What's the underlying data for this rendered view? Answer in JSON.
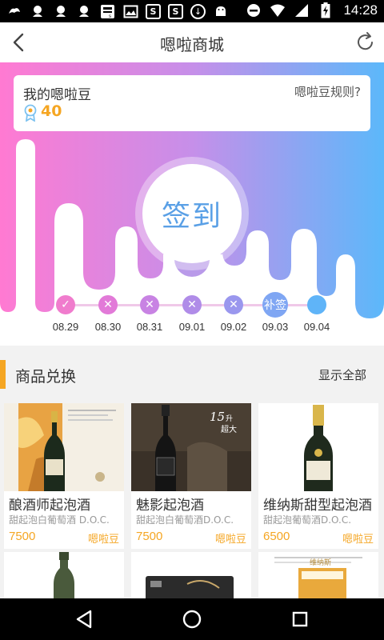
{
  "status_bar": {
    "time": "14:28",
    "icons": [
      "qq-icon",
      "qq-icon",
      "qq-icon",
      "qq-icon",
      "s-app-icon",
      "image-icon",
      "s5-icon",
      "s5-icon",
      "download-icon",
      "android-icon",
      "dnd-icon",
      "wifi-icon",
      "signal-icon",
      "battery-charging-icon"
    ]
  },
  "header": {
    "title": "嗯啦商城"
  },
  "beans": {
    "label": "我的嗯啦豆",
    "count": "40",
    "rules_label": "嗯啦豆规则?"
  },
  "signin": {
    "label": "签到"
  },
  "checkins": [
    {
      "date": "08.29",
      "status": "done",
      "symbol": "✓",
      "color": "#f07ccd"
    },
    {
      "date": "08.30",
      "status": "missed",
      "symbol": "✕",
      "color": "#e27ad8"
    },
    {
      "date": "08.31",
      "status": "missed",
      "symbol": "✕",
      "color": "#c883e3"
    },
    {
      "date": "09.01",
      "status": "missed",
      "symbol": "✕",
      "color": "#b08ce8"
    },
    {
      "date": "09.02",
      "status": "missed",
      "symbol": "✕",
      "color": "#9a97ee"
    },
    {
      "date": "09.03",
      "status": "makeup",
      "symbol": "补签",
      "color": "#7fa6f3"
    },
    {
      "date": "09.04",
      "status": "today",
      "symbol": "",
      "color": "#5fb4f8"
    }
  ],
  "exchange": {
    "title": "商品兑换",
    "show_all": "显示全部"
  },
  "products": [
    {
      "name": "酿酒师起泡酒",
      "desc": "甜起泡白葡萄酒 D.O.C.",
      "price": "7500",
      "unit": "嗯啦豆"
    },
    {
      "name": "魅影起泡酒",
      "desc": "甜起泡白葡萄酒D.O.C.",
      "price": "7500",
      "unit": "嗯啦豆"
    },
    {
      "name": "维纳斯甜型起泡酒",
      "desc": "甜起泡葡萄酒D.O.C.",
      "price": "6500",
      "unit": "嗯啦豆"
    }
  ],
  "product_image_text": {
    "p2_badge_top": "15",
    "p2_badge_mid": "升",
    "p2_badge_big": "超大",
    "p3_head": "维纳斯"
  },
  "colors": {
    "accent": "#f5a623",
    "gradient_left": "#ff7ad2",
    "gradient_right": "#5cb8fa",
    "signin_text": "#5aa0e6"
  }
}
